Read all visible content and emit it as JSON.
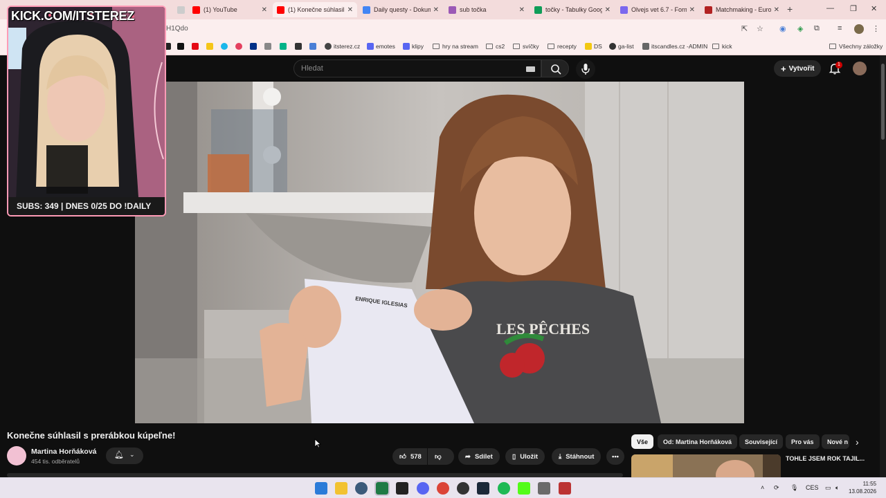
{
  "browser": {
    "tabs": [
      {
        "label": "(1) YouTube",
        "color": "#ff0000"
      },
      {
        "label": "(1) Konečne súhlasil s prerábkou",
        "color": "#ff0000"
      },
      {
        "label": "Daily questy - Dokum",
        "color": "#4285f4"
      },
      {
        "label": "sub točka",
        "color": "#9b59b6"
      },
      {
        "label": "točky - Tabulky Goog",
        "color": "#0f9d58"
      },
      {
        "label": "Olvejs vet 6.7 - Form",
        "color": "#7b68ee"
      },
      {
        "label": "Matchmaking - Europ",
        "color": "#b22222"
      }
    ],
    "new_tab": "+",
    "window_controls": [
      "—",
      "❐",
      "✕"
    ],
    "url": "H1Qdo",
    "bookmarks": [
      {
        "label": "itsterez.cz",
        "kind": "site"
      },
      {
        "label": "emotes",
        "kind": "site"
      },
      {
        "label": "klipy",
        "kind": "site"
      },
      {
        "label": "hry na stream",
        "kind": "folder"
      },
      {
        "label": "cs2",
        "kind": "folder"
      },
      {
        "label": "svíčky",
        "kind": "folder"
      },
      {
        "label": "recepty",
        "kind": "folder"
      },
      {
        "label": "DS",
        "kind": "site"
      },
      {
        "label": "ga-list",
        "kind": "site"
      },
      {
        "label": "itscandles.cz -ADMIN",
        "kind": "site"
      },
      {
        "label": "kick",
        "kind": "folder"
      }
    ],
    "all_bookmarks": "Všechny záložky"
  },
  "youtube": {
    "search_placeholder": "Hledat",
    "create_label": "Vytvořit",
    "notifications_count": "1",
    "video": {
      "title": "Konečne súhlasil s prerábkou kúpeľne!",
      "channel": "Martina Horňáková",
      "subscribers": "454 tis. odběratelů",
      "likes": "578",
      "share": "Sdílet",
      "save": "Uložit",
      "download": "Stáhnout",
      "paper_text": "ENRIQUE IGLESIAS",
      "shirt_text": "LES PÊCHES"
    },
    "chips": [
      {
        "label": "Vše",
        "selected": true
      },
      {
        "label": "Od: Martina Horňáková",
        "selected": false
      },
      {
        "label": "Související",
        "selected": false
      },
      {
        "label": "Pro vás",
        "selected": false
      },
      {
        "label": "Nové n",
        "selected": false
      }
    ],
    "recommended": {
      "title": "TOHLE JSEM ROK TAJIL..."
    }
  },
  "overlay": {
    "brand": "KICK.COM/ITSTEREZ",
    "subs_text": "SUBS: 349 | DNES 0/25 DO !DAILY",
    "border_color": "#ff9bb6"
  },
  "taskbar": {
    "language": "CES",
    "time": "11:55",
    "date": "13.08.2026"
  }
}
